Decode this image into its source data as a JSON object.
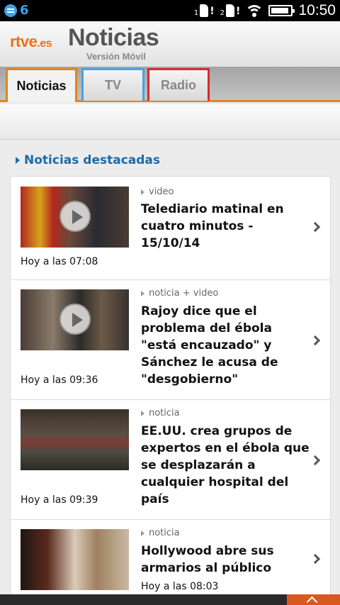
{
  "status_bar": {
    "notification_count": "6",
    "sim1": "1",
    "sim2": "2",
    "battery_level": 0.9,
    "time": "10:50"
  },
  "header": {
    "brand": "rtve",
    "brand_domain": ".es",
    "title": "Noticias",
    "subtitle": "Versión Móvil"
  },
  "tabs": [
    {
      "label": "Noticias",
      "color": "#e0851f",
      "active": true
    },
    {
      "label": "TV",
      "color": "#47a3e6",
      "active": false
    },
    {
      "label": "Radio",
      "color": "#d62a34",
      "active": false
    }
  ],
  "section": {
    "title": "Noticias destacadas"
  },
  "news": [
    {
      "kind": "video",
      "title": "Telediario matinal en cuatro minutos - 15/10/14",
      "time": "Hoy a las 07:08",
      "has_play": true
    },
    {
      "kind": "noticia + video",
      "title": "Rajoy dice que el problema del ébola \"está encauzado\" y Sánchez le acusa de \"desgobierno\"",
      "time": "Hoy a las 09:36",
      "has_play": true
    },
    {
      "kind": "noticia",
      "title": "EE.UU. crea grupos de expertos en el ébola que se desplazarán a cualquier hospital del país",
      "time": "Hoy a las 09:39",
      "has_play": false
    },
    {
      "kind": "noticia",
      "title": "Hollywood abre sus armarios al público",
      "time": "Hoy a las 08:03",
      "has_play": false
    }
  ],
  "colors": {
    "accent": "#e0851f",
    "link": "#1e6aa6"
  }
}
